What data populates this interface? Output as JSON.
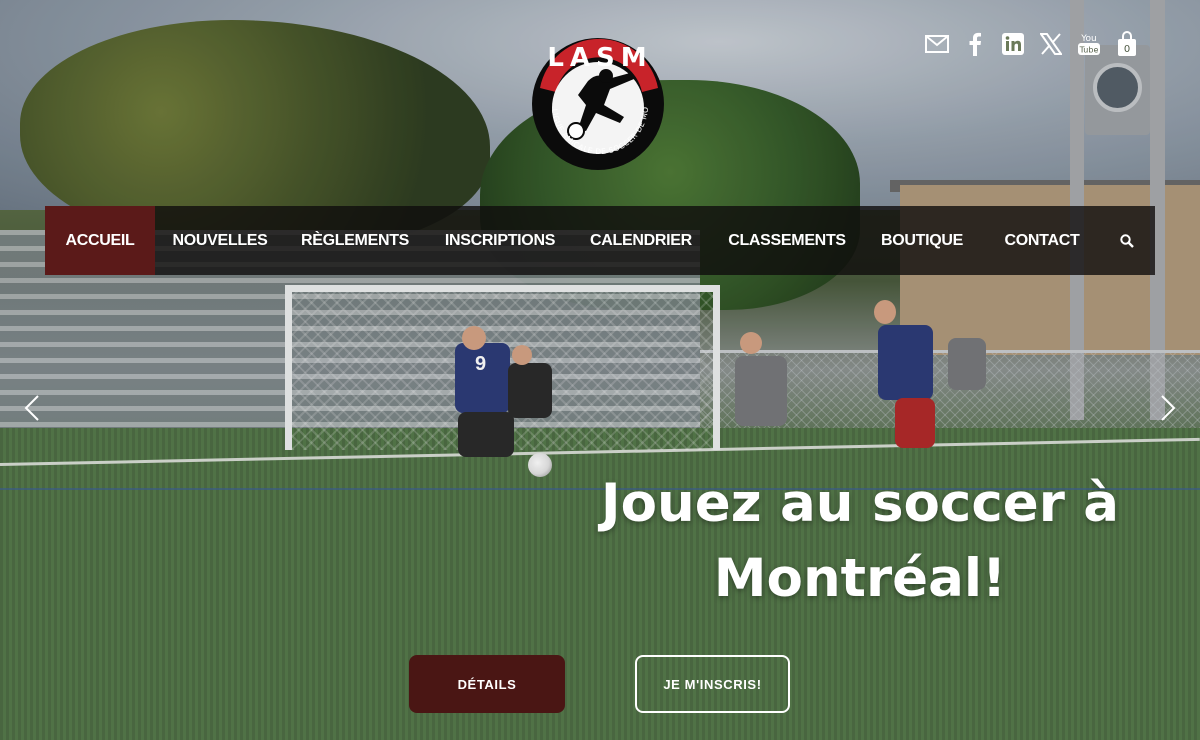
{
  "logo": {
    "arc_text": "LASM",
    "ring_text": "LIGUE AMICALE DE SOCCER DE MONTRÉAL"
  },
  "social": {
    "icons": [
      "mail-icon",
      "facebook-icon",
      "linkedin-icon",
      "x-icon",
      "youtube-icon",
      "cart-icon"
    ],
    "youtube_text": "You Tube",
    "cart_count": "0"
  },
  "nav": {
    "items": [
      {
        "label": "ACCUEIL",
        "active": true
      },
      {
        "label": "NOUVELLES"
      },
      {
        "label": "RÈGLEMENTS"
      },
      {
        "label": "INSCRIPTIONS"
      },
      {
        "label": "CALENDRIER"
      },
      {
        "label": "CLASSEMENTS"
      },
      {
        "label": "BOUTIQUE"
      },
      {
        "label": "CONTACT"
      }
    ],
    "search_icon": "search-icon"
  },
  "hero": {
    "headline_line1": "Jouez au soccer à",
    "headline_line2": "Montréal!",
    "details_label": "DÉTAILS",
    "signup_label": "JE M'INSCRIS!",
    "player_number": "9"
  },
  "colors": {
    "accent": "#5b1a19",
    "button_dark": "#4a1614",
    "nav_bg": "rgba(15,12,12,0.8)"
  }
}
